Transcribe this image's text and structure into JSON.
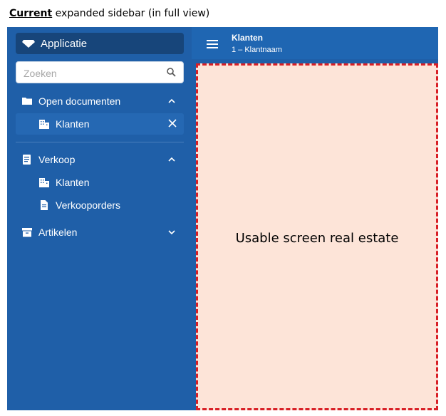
{
  "caption": {
    "bold": "Current",
    "rest": " expanded sidebar (in full view)"
  },
  "sidebar": {
    "app_label": "Applicatie",
    "search_placeholder": "Zoeken",
    "open_documents": {
      "label": "Open documenten",
      "items": [
        {
          "label": "Klanten"
        }
      ]
    },
    "sections": [
      {
        "label": "Verkoop",
        "expanded": true,
        "items": [
          {
            "label": "Klanten"
          },
          {
            "label": "Verkooporders"
          }
        ]
      },
      {
        "label": "Artikelen",
        "expanded": false,
        "items": []
      }
    ]
  },
  "topbar": {
    "title": "Klanten",
    "subtitle": "1 – Klantnaam"
  },
  "content": {
    "label": "Usable screen real estate"
  },
  "colors": {
    "sidebar_bg": "#1f5fa8",
    "topbar_bg": "#1f66b2",
    "app_button_bg": "#17457a",
    "usable_fill": "#fde4d8",
    "usable_border": "#d81f26"
  },
  "icons": {
    "app": "diamond-icon",
    "search": "search-icon",
    "folder": "folder-icon",
    "building": "building-icon",
    "ledger": "book-icon",
    "document": "document-icon",
    "archive": "archive-icon",
    "menu": "hamburger-icon"
  }
}
